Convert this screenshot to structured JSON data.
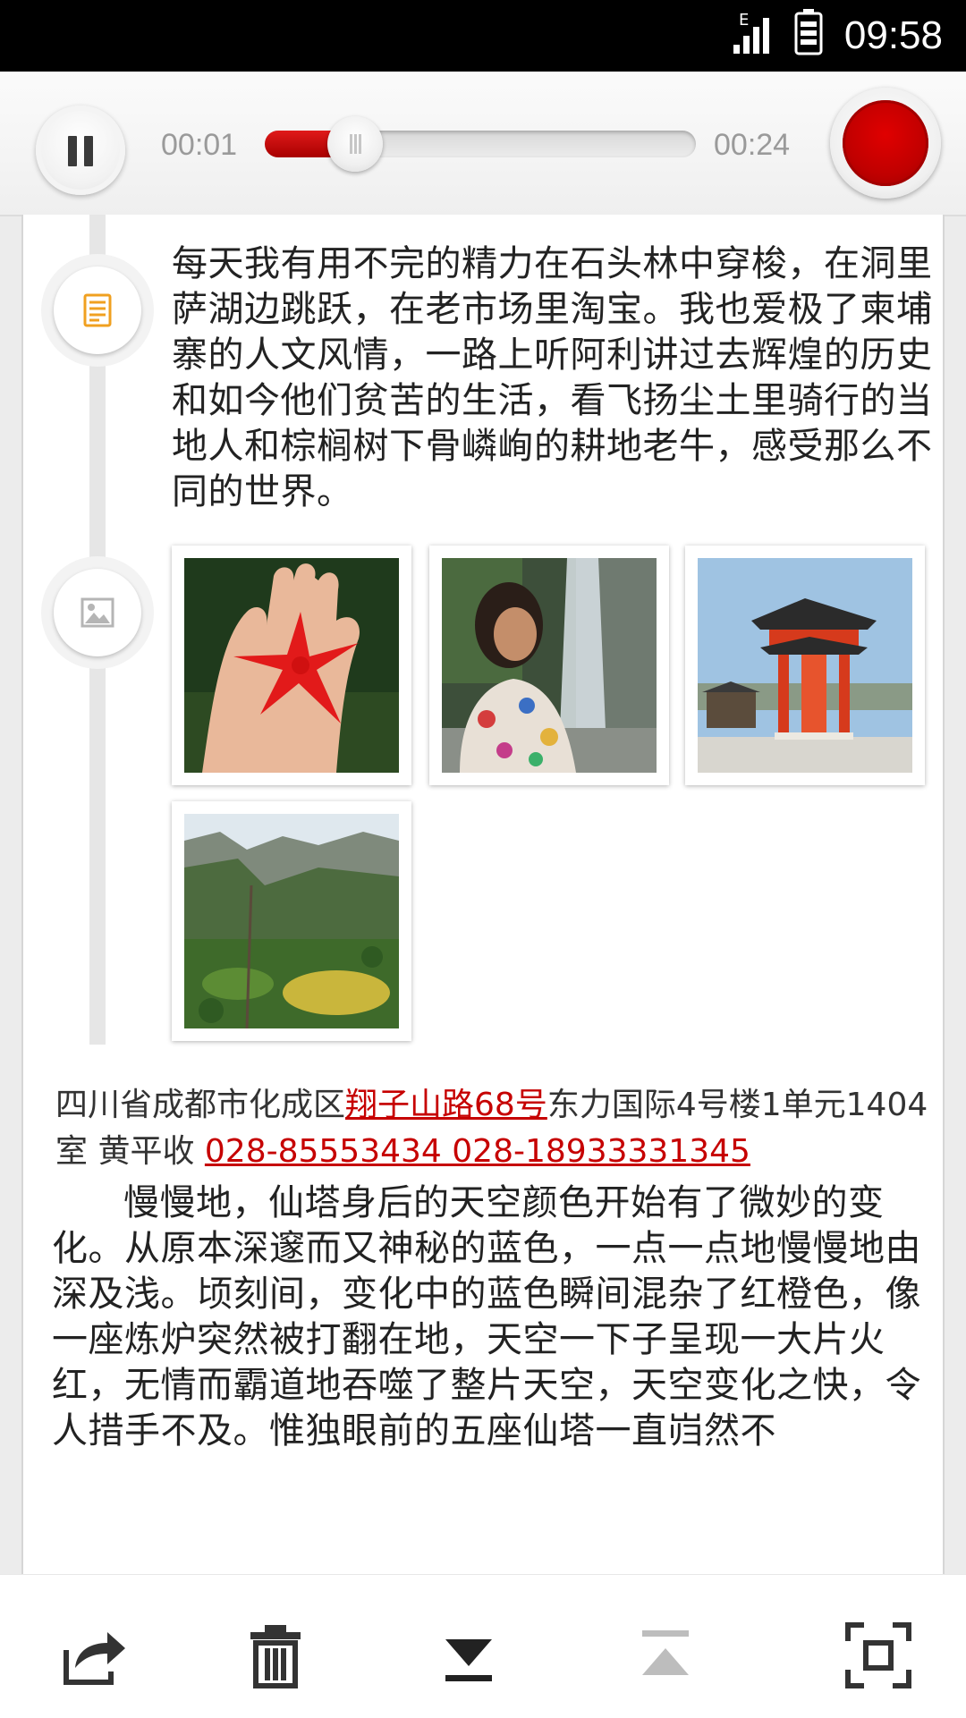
{
  "status_bar": {
    "time": "09:58",
    "network": "E"
  },
  "player": {
    "elapsed": "00:01",
    "duration": "00:24",
    "progress_fraction": 0.18
  },
  "entry": {
    "text": "每天我有用不完的精力在石头林中穿梭，在洞里萨湖边跳跃，在老市场里淘宝。我也爱极了柬埔寨的人文风情，一路上听阿利讲过去辉煌的历史和如今他们贫苦的生活，看飞扬尘土里骑行的当地人和棕榈树下骨嶙峋的耕地老牛，感受那么不同的世界。"
  },
  "photos": [
    {
      "name": "starfish-in-hand-photo"
    },
    {
      "name": "girl-by-waterfall-photo"
    },
    {
      "name": "red-temple-gate-photo"
    },
    {
      "name": "valley-landscape-photo"
    }
  ],
  "address": {
    "prefix": "四川省成都市化成区",
    "street_link": "翔子山路68号",
    "middle": "东力国际4号楼1单元1404室 黄平收 ",
    "phone_link": "028-85553434  028-18933331345"
  },
  "body_text": "慢慢地，仙塔身后的天空颜色开始有了微妙的变化。从原本深邃而又神秘的蓝色，一点一点地慢慢地由深及浅。顷刻间，变化中的蓝色瞬间混杂了红橙色，像一座炼炉突然被打翻在地，天空一下子呈现一大片火红，无情而霸道地吞噬了整片天空，天空变化之快，令人措手不及。惟独眼前的五座仙塔一直岿然不",
  "toolbar": {
    "icons": [
      "share-icon",
      "delete-icon",
      "scroll-bottom-icon",
      "scroll-top-icon",
      "fullscreen-icon"
    ]
  },
  "colors": {
    "accent": "#c60000",
    "record": "#c00000"
  }
}
